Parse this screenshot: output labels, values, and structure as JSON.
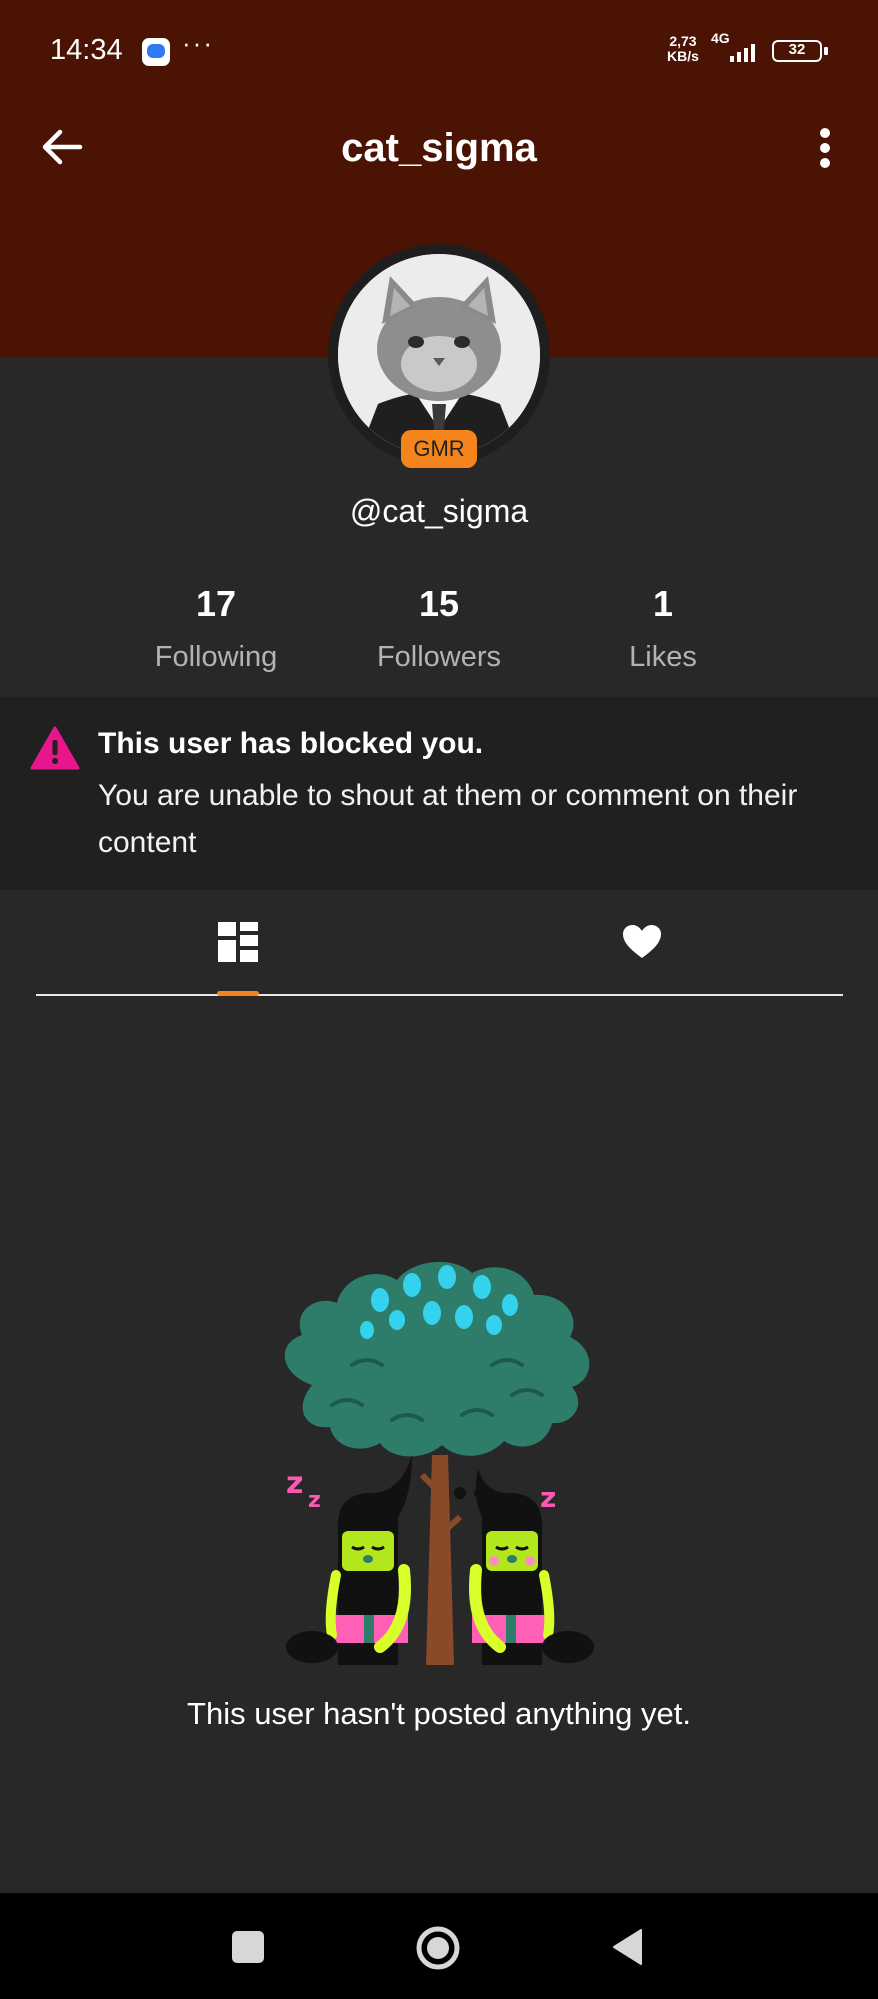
{
  "status_bar": {
    "time": "14:34",
    "dots": "···",
    "speed_value": "2,73",
    "speed_unit": "KB/s",
    "network": "4G",
    "battery": "32"
  },
  "header": {
    "title": "cat_sigma",
    "back_icon": "arrow-left-icon",
    "menu_icon": "more-vertical-icon"
  },
  "profile": {
    "badge": "GMR",
    "handle": "@cat_sigma",
    "stats": [
      {
        "value": "17",
        "label": "Following"
      },
      {
        "value": "15",
        "label": "Followers"
      },
      {
        "value": "1",
        "label": "Likes"
      }
    ]
  },
  "notice": {
    "title": "This user has blocked you.",
    "message": "You are unable to shout at them or comment on their content",
    "icon": "warning-triangle-icon",
    "icon_color": "#e8168c"
  },
  "tabs": {
    "items": [
      {
        "icon": "grid-layout-icon",
        "active": true
      },
      {
        "icon": "heart-icon",
        "active": false
      }
    ],
    "accent": "#f4841c"
  },
  "empty_state": {
    "message": "This user hasn't posted anything yet."
  },
  "colors": {
    "header_bg": "#4a1303",
    "body_bg": "#282828",
    "panel_bg": "#202020",
    "badge": "#f4841c"
  }
}
